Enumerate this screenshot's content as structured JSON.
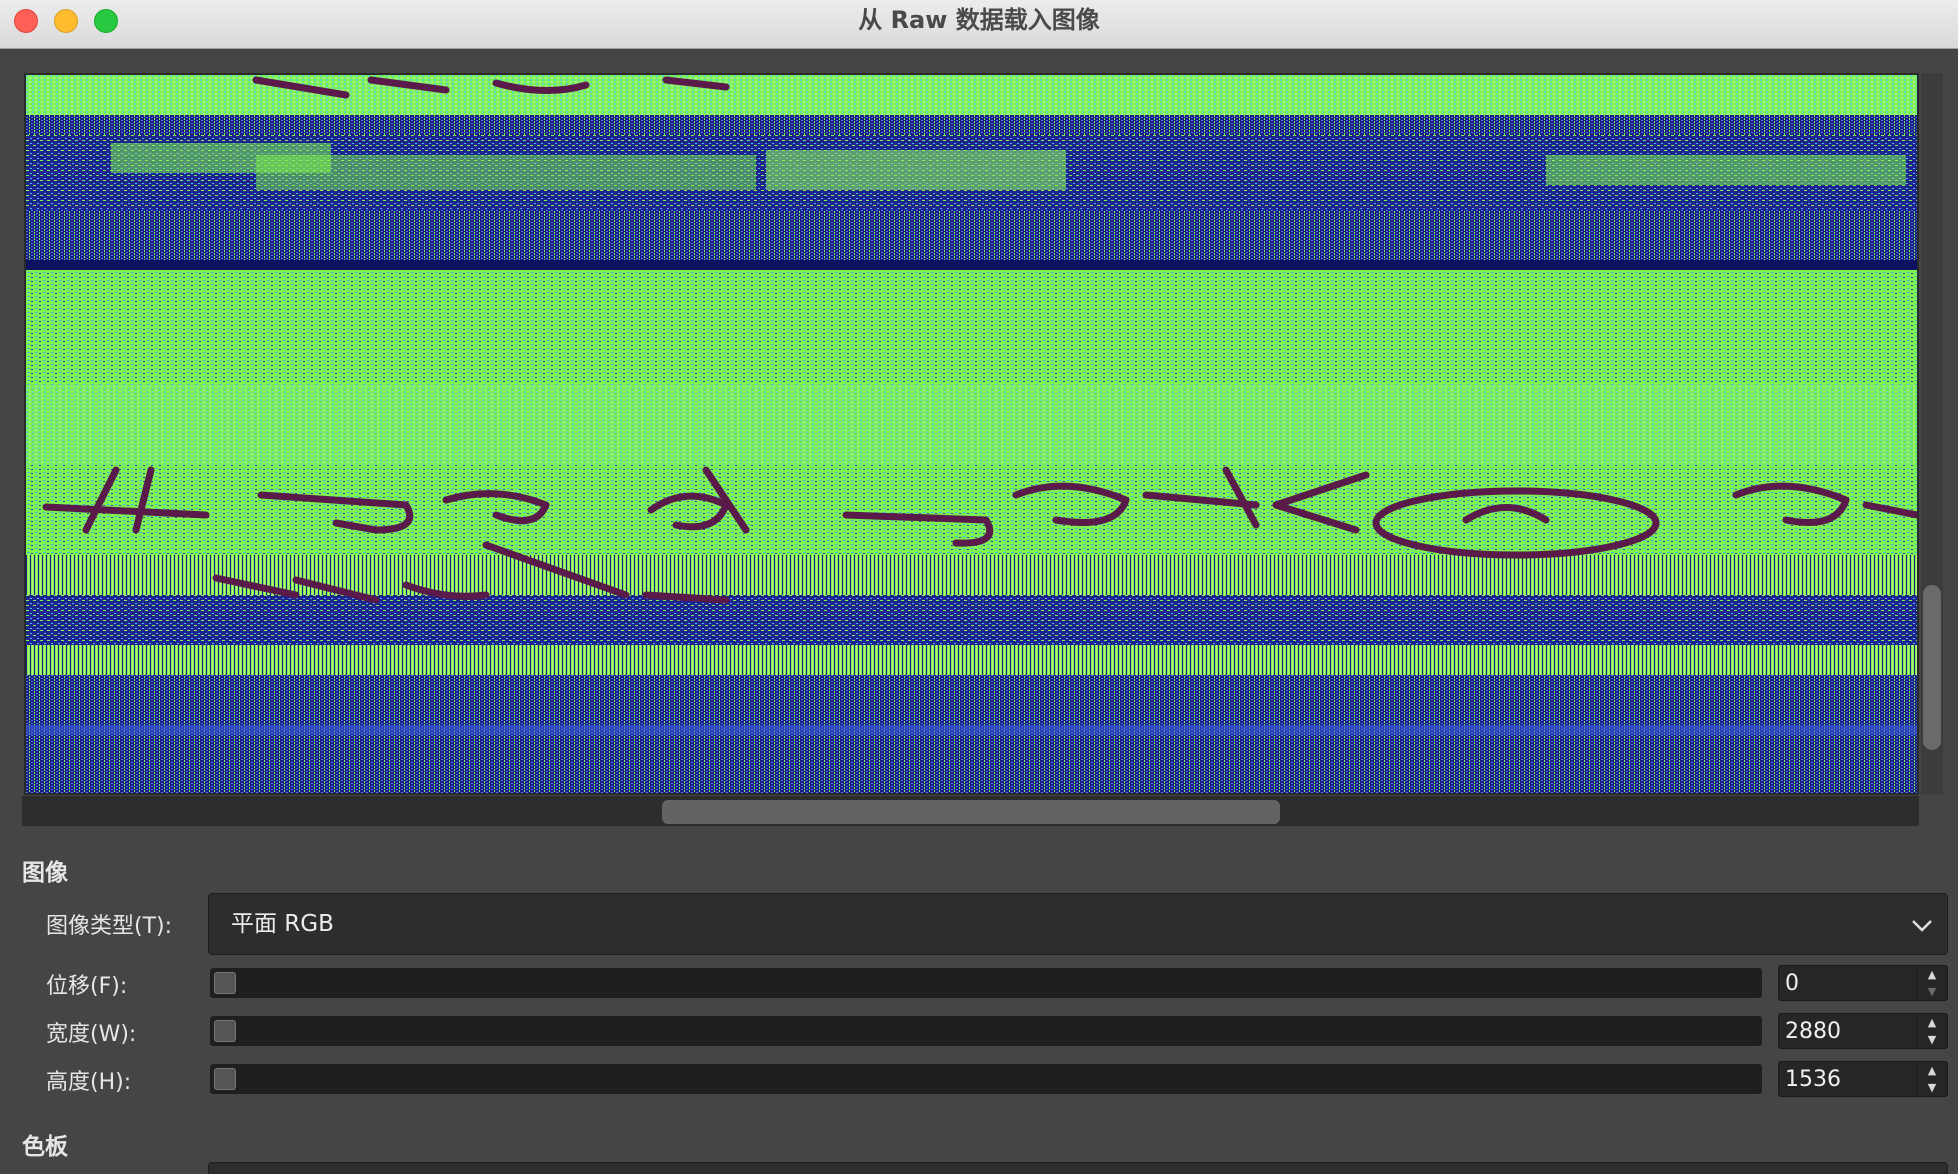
{
  "window": {
    "title": "从 Raw 数据载入图像"
  },
  "image_section": {
    "title": "图像",
    "image_type": {
      "label": "图像类型(T):",
      "value": "平面 RGB"
    },
    "offset": {
      "label": "位移(F):",
      "value": "0",
      "slider_fraction": 0
    },
    "width": {
      "label": "宽度(W):",
      "value": "2880",
      "slider_fraction": 0
    },
    "height": {
      "label": "高度(H):",
      "value": "1536",
      "slider_fraction": 0
    }
  },
  "palette_section": {
    "title": "色板"
  },
  "colors": {
    "preview_green": "#7ef24e",
    "preview_navy": "#1c1d8a",
    "ink": "#5a1a4a",
    "dialog_bg": "#454545"
  },
  "icons": {
    "close": "close-icon",
    "minimize": "minimize-icon",
    "zoom": "zoom-icon",
    "dropdown": "chevron-down-icon",
    "spin_up": "arrow-up-icon",
    "spin_down": "arrow-down-icon"
  }
}
